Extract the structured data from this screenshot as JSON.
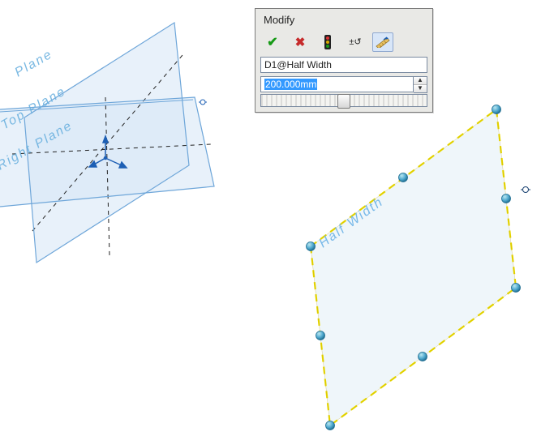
{
  "dialog": {
    "title": "Modify",
    "param_name": "D1@Half Width",
    "value": "200.000mm",
    "ok_tip": "OK",
    "cancel_tip": "Cancel",
    "rebuild_tip": "Rebuild",
    "reverse_tip": "Reverse",
    "thumbwheel_tip": "Thumbwheel"
  },
  "planes": {
    "top": "Top Plane",
    "right": "Right Plane",
    "front_partial": "Plane"
  },
  "sketch_label": "Half Width",
  "colors": {
    "plane_edge": "#6ea6d9",
    "plane_fill": "#d9e7f6",
    "sketch_edge": "#e8d900",
    "handle_fill": "#5bb3d1",
    "handle_stroke": "#1b6b8f"
  }
}
